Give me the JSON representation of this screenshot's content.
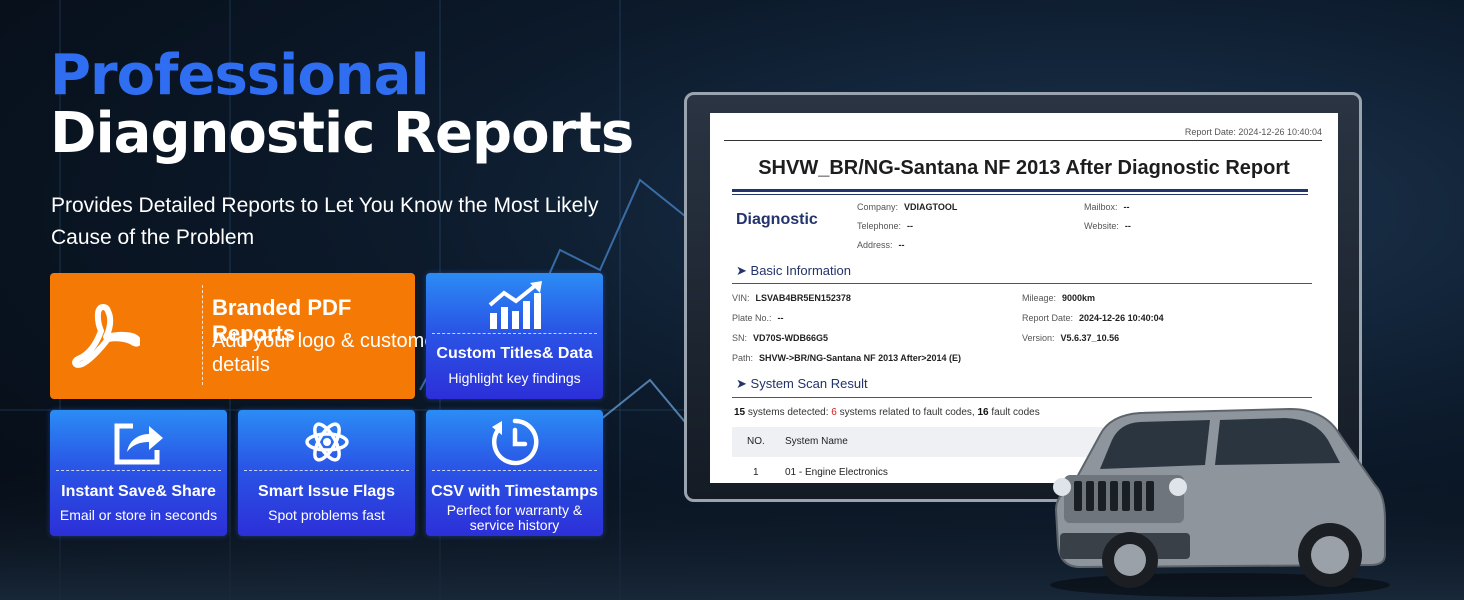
{
  "hero": {
    "title_line1": "Professional",
    "title_line2": "Diagnostic Reports",
    "subtitle": "Provides Detailed Reports to Let You Know the Most Likely Cause of the Problem"
  },
  "features": [
    {
      "title": "Branded PDF Reports",
      "desc": "Add your logo & customer details",
      "icon": "pdf-icon"
    },
    {
      "title": "Custom Titles& Data",
      "desc": "Highlight key findings",
      "icon": "growth-chart-icon"
    },
    {
      "title": "Instant Save& Share",
      "desc": "Email or store in seconds",
      "icon": "share-icon"
    },
    {
      "title": "Smart Issue Flags",
      "desc": "Spot problems fast",
      "icon": "atom-icon"
    },
    {
      "title": "CSV with Timestamps",
      "desc": "Perfect for warranty & service history",
      "icon": "clock-icon"
    }
  ],
  "report": {
    "report_date": "Report Date: 2024-12-26 10:40:04",
    "title": "SHVW_BR/NG-Santana NF 2013 After  Diagnostic Report",
    "brand": "Diagnostic",
    "company": {
      "label": "Company:",
      "value": "VDIAGTOOL"
    },
    "telephone": {
      "label": "Telephone:",
      "value": "--"
    },
    "address": {
      "label": "Address:",
      "value": "--"
    },
    "mailbox": {
      "label": "Mailbox:",
      "value": "--"
    },
    "website": {
      "label": "Website:",
      "value": "--"
    },
    "basic_info_heading": "Basic Information",
    "vin": {
      "label": "VIN:",
      "value": "LSVAB4BR5EN152378"
    },
    "plate": {
      "label": "Plate No.:",
      "value": "--"
    },
    "sn": {
      "label": "SN:",
      "value": "VD70S-WDB66G5"
    },
    "path": {
      "label": "Path:",
      "value": "SHVW->BR/NG-Santana NF 2013 After>2014 (E)"
    },
    "mileage": {
      "label": "Mileage:",
      "value": "9000km"
    },
    "report_date_field": {
      "label": "Report Date:",
      "value": "2024-12-26 10:40:04"
    },
    "version": {
      "label": "Version:",
      "value": "V5.6.37_10.56"
    },
    "scan_heading": "System Scan Result",
    "summary": {
      "systems": "15",
      "text1": " systems detected: ",
      "fault_systems": "6",
      "text2": " systems related to fault codes, ",
      "fault_codes": "16",
      "text3": " fault codes"
    },
    "table_headers": [
      "NO.",
      "System Name"
    ],
    "rows": [
      [
        "1",
        "01 - Engine Electronics"
      ]
    ]
  }
}
